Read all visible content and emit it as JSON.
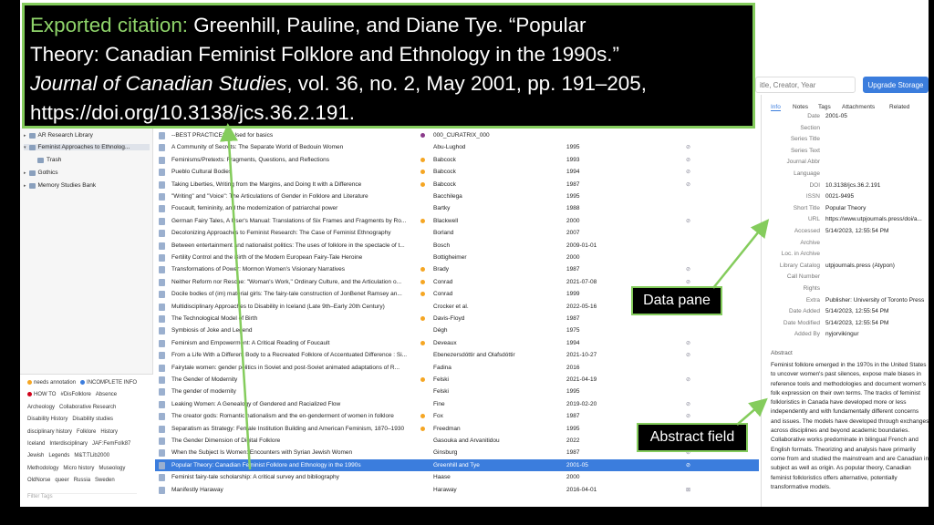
{
  "overlay": {
    "lead": "Exported citation:",
    "line1_rest": "Greenhill, Pauline, and Diane Tye. “Popular",
    "line2": "Theory: Canadian Feminist Folklore and Ethnology in the 1990s.”",
    "journal": "Journal of Canadian Studies",
    "line3_rest": ", vol. 36, no. 2, May 2001, pp. 191–205,",
    "line4": "https://doi.org/10.3138/jcs.36.2.191."
  },
  "callouts": {
    "data_pane": "Data pane",
    "abstract_field": "Abstract field"
  },
  "toolbar": {
    "search_placeholder": "itle, Creator, Year",
    "upgrade_label": "Upgrade Storage"
  },
  "libraries": [
    {
      "label": "AR Research Library",
      "twisty": "▸"
    },
    {
      "label": "Feminist Approaches to Ethnolog...",
      "twisty": "▾"
    },
    {
      "label": "Trash",
      "twisty": ""
    },
    {
      "label": "Gothics",
      "twisty": "▸"
    },
    {
      "label": "Memory Studies Bank",
      "twisty": "▸"
    }
  ],
  "tags": {
    "rows": [
      [
        "needs annotation",
        "INCOMPLETE INFO"
      ],
      [
        "HOW TO",
        "#DisFolklore",
        "Absence"
      ],
      [
        "Archeology",
        "Collaborative Research"
      ],
      [
        "Disability History",
        "Disability studies"
      ],
      [
        "disciplinary history",
        "Folklore",
        "History"
      ],
      [
        "Iceland",
        "Interdisciplinary",
        "JAF:FemFolk87"
      ],
      [
        "Jewish",
        "Legends",
        "M&T:TLib2000"
      ],
      [
        "Methodology",
        "Micro history",
        "Museology"
      ],
      [
        "OldNorse",
        "queer",
        "Russia",
        "Sweden"
      ]
    ],
    "filter_placeholder": "Filter Tags",
    "colors": {
      "needs_annotation": "#f5a623",
      "incomplete_info": "#3b7ddd",
      "how_to": "#d0021b"
    }
  },
  "items": [
    {
      "title": "--BEST PRACTICES-- Used for basics",
      "creator": "000_CURATRIX_000",
      "date": "",
      "dot": "#8b3a8b",
      "att": ""
    },
    {
      "title": "A Community of Secrets: The Separate World of Bedouin Women",
      "creator": "Abu-Lughod",
      "date": "1995",
      "dot": "",
      "att": "⊘"
    },
    {
      "title": "Feminisms/Pretexts: Fragments, Questions, and Reflections",
      "creator": "Babcock",
      "date": "1993",
      "dot": "#f5a623",
      "att": "⊘"
    },
    {
      "title": "Pueblo Cultural Bodies",
      "creator": "Babcock",
      "date": "1994",
      "dot": "#f5a623",
      "att": "⊘"
    },
    {
      "title": "Taking Liberties, Writing from the Margins, and Doing It with a Difference",
      "creator": "Babcock",
      "date": "1987",
      "dot": "#f5a623",
      "att": "⊘"
    },
    {
      "title": "\"Writing\" and \"Voice\": The Articulations of Gender in Folklore and Literature",
      "creator": "Bacchilega",
      "date": "1995",
      "dot": "",
      "att": ""
    },
    {
      "title": "Foucault, femininity, and the modernization of patriarchal power",
      "creator": "Bartky",
      "date": "1988",
      "dot": "",
      "att": ""
    },
    {
      "title": "German Fairy Tales, A User's Manual: Translations of Six Frames and Fragments by Ro...",
      "creator": "Blackwell",
      "date": "2000",
      "dot": "#f5a623",
      "att": "⊘"
    },
    {
      "title": "Decolonizing Approaches to Feminist Research: The Case of Feminist Ethnography",
      "creator": "Borland",
      "date": "2007",
      "dot": "",
      "att": ""
    },
    {
      "title": "Between entertainment and nationalist politics: The uses of folklore in the spectacle of t...",
      "creator": "Bosch",
      "date": "2009-01-01",
      "dot": "",
      "att": ""
    },
    {
      "title": "Fertility Control and the Birth of the Modern European Fairy-Tale Heroine",
      "creator": "Bottigheimer",
      "date": "2000",
      "dot": "",
      "att": ""
    },
    {
      "title": "Transformations of Power: Mormon Women's Visionary Narratives",
      "creator": "Brady",
      "date": "1987",
      "dot": "#f5a623",
      "att": "⊘"
    },
    {
      "title": "Neither Reform nor Rescue: \"Woman's Work,\" Ordinary Culture, and the Articulation o...",
      "creator": "Conrad",
      "date": "2021-07-08",
      "dot": "#f5a623",
      "att": "⊘"
    },
    {
      "title": "Docile bodies of (im) material girls: The fairy-tale construction of JonBenet Ramsey an...",
      "creator": "Conrad",
      "date": "1999",
      "dot": "#f5a623",
      "att": "⊘"
    },
    {
      "title": "Multidisciplinary Approaches to Disability in Iceland (Late 9th–Early 20th Century)",
      "creator": "Crocker et al.",
      "date": "2022-05-16",
      "dot": "",
      "att": "⊘"
    },
    {
      "title": "The Technological Model of Birth",
      "creator": "Davis-Floyd",
      "date": "1987",
      "dot": "#f5a623",
      "att": ""
    },
    {
      "title": "Symbiosis of Joke and Legend",
      "creator": "Dégh",
      "date": "1975",
      "dot": "",
      "att": ""
    },
    {
      "title": "Feminism and Empowerment: A Critical Reading of Foucault",
      "creator": "Deveaux",
      "date": "1994",
      "dot": "#f5a623",
      "att": "⊘"
    },
    {
      "title": "From a Life With a Different Body to a Recreated Folklore of Accentuated Difference : Si...",
      "creator": "Ebenezersdóttir and Ólafsdóttir",
      "date": "2021-10-27",
      "dot": "",
      "att": "⊘"
    },
    {
      "title": "Fairytale women: gender politics in Soviet and post-Soviet animated adaptations of R...",
      "creator": "Fadina",
      "date": "2016",
      "dot": "",
      "att": ""
    },
    {
      "title": "The Gender of Modernity",
      "creator": "Felski",
      "date": "2021-04-19",
      "dot": "#f5a623",
      "att": "⊘"
    },
    {
      "title": "The gender of modernity",
      "creator": "Felski",
      "date": "1995",
      "dot": "",
      "att": ""
    },
    {
      "title": "Leaking Women: A Genealogy of Gendered and Racialized Flow",
      "creator": "Fine",
      "date": "2019-02-20",
      "dot": "",
      "att": "⊘"
    },
    {
      "title": "The creator gods: Romantic nationalism and the en-genderment of women in folklore",
      "creator": "Fox",
      "date": "1987",
      "dot": "#f5a623",
      "att": "⊘"
    },
    {
      "title": "Separatism as Strategy: Female Institution Building and American Feminism, 1870–1930",
      "creator": "Freedman",
      "date": "1995",
      "dot": "#f5a623",
      "att": "⊘"
    },
    {
      "title": "The Gender Dimension of Digital Folklore",
      "creator": "Gasouka and Arvanitidou",
      "date": "2022",
      "dot": "",
      "att": "⊘"
    },
    {
      "title": "When the Subject Is Women: Encounters with Syrian Jewish Women",
      "creator": "Ginsburg",
      "date": "1987",
      "dot": "",
      "att": "⊘"
    },
    {
      "title": "Popular Theory: Canadian Feminist Folklore and Ethnology in the 1990s",
      "creator": "Greenhill and Tye",
      "date": "2001-05",
      "dot": "",
      "att": "⊘"
    },
    {
      "title": "Feminist fairy-tale scholarship: A critical survey and bibliography",
      "creator": "Haase",
      "date": "2000",
      "dot": "",
      "att": ""
    },
    {
      "title": "Manifestly Haraway",
      "creator": "Haraway",
      "date": "2016-04-01",
      "dot": "",
      "att": "⊠"
    }
  ],
  "right_tabs": [
    "Info",
    "Notes",
    "Tags",
    "Attachments",
    "Related"
  ],
  "fields": [
    {
      "label": "Date",
      "value": "2001-05"
    },
    {
      "label": "Section",
      "value": ""
    },
    {
      "label": "Series Title",
      "value": ""
    },
    {
      "label": "Series Text",
      "value": ""
    },
    {
      "label": "Journal Abbr",
      "value": ""
    },
    {
      "label": "Language",
      "value": ""
    },
    {
      "label": "DOI",
      "value": "10.3138/jcs.36.2.191"
    },
    {
      "label": "ISSN",
      "value": "0021-9495"
    },
    {
      "label": "Short Title",
      "value": "Popular Theory"
    },
    {
      "label": "URL",
      "value": "https://www.utpjournals.press/doi/a..."
    },
    {
      "label": "Accessed",
      "value": "5/14/2023, 12:55:54 PM"
    },
    {
      "label": "Archive",
      "value": ""
    },
    {
      "label": "Loc. in Archive",
      "value": ""
    },
    {
      "label": "Library Catalog",
      "value": "utpjournals.press (Atypon)"
    },
    {
      "label": "Call Number",
      "value": ""
    },
    {
      "label": "Rights",
      "value": ""
    },
    {
      "label": "Extra",
      "value": "Publisher: University of Toronto Press"
    },
    {
      "label": "Date Added",
      "value": "5/14/2023, 12:55:54 PM"
    },
    {
      "label": "Date Modified",
      "value": "5/14/2023, 12:55:54 PM"
    },
    {
      "label": "Added By",
      "value": "nyjorvikingur"
    }
  ],
  "abstract": {
    "label": "Abstract",
    "text": "Feminist folklore emerged in the 1970s in the United States to uncover women's past silences, expose male biases in reference tools and methodologies and document women's folk expression on their own terms. The tracks of feminist folkloristics in Canada have developed more or less independently and with fundamentally different concerns and issues. The models have developed through exchanges across disciplines and beyond academic boundaries. Collaborative works predominate in bilingual French and English formats. Theorizing and analysis have primarily come from and studied the mainstream and are Canadian in subject as well as origin. As popular theory, Canadian feminist folkloristics offers alternative, potentially transformative models."
  }
}
